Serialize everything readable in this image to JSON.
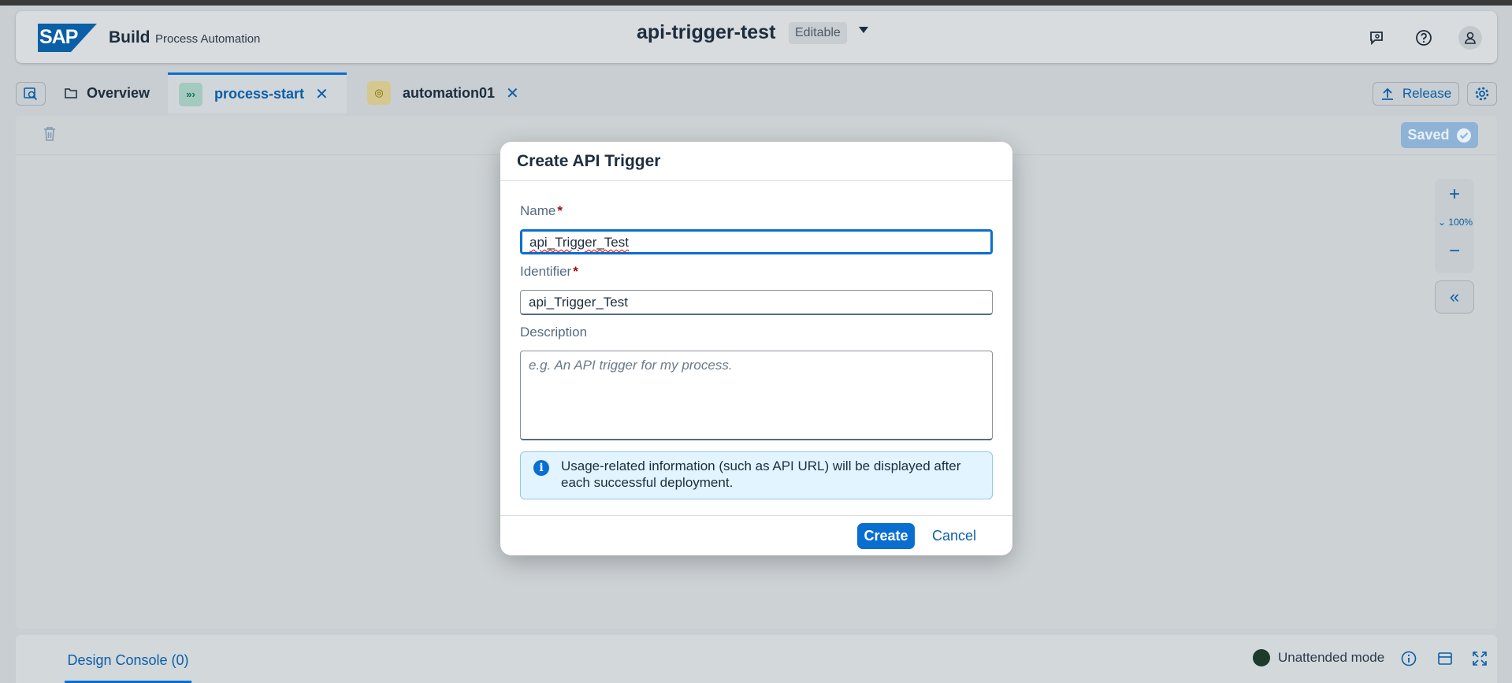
{
  "shell": {
    "logo_text": "SAP",
    "brand": "Build",
    "product": "Process Automation",
    "project_title": "api-trigger-test",
    "mode": "Editable"
  },
  "tabs": [
    {
      "label": "Overview"
    },
    {
      "label": "process-start"
    },
    {
      "label": "automation01"
    }
  ],
  "toolbar": {
    "release_label": "Release",
    "saved_label": "Saved",
    "zoom_level": "100%"
  },
  "bottom": {
    "console_label": "Design Console (0)",
    "mode_label": "Unattended mode"
  },
  "dialog": {
    "title": "Create API Trigger",
    "name_label": "Name",
    "name_value": "api_Trigger_Test",
    "identifier_label": "Identifier",
    "identifier_value": "api_Trigger_Test",
    "description_label": "Description",
    "description_placeholder": "e.g. An API trigger for my process.",
    "info_text": "Usage-related information (such as API URL) will be displayed after each successful deployment.",
    "create_label": "Create",
    "cancel_label": "Cancel",
    "required_mark": "*"
  },
  "colors": {
    "accent": "#0a6ed1",
    "required": "#aa0808",
    "info_bg": "#e1f4ff"
  }
}
